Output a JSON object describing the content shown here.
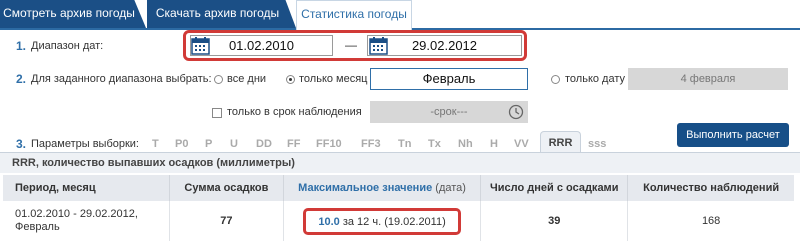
{
  "tabs": [
    {
      "label": "Смотреть архив погоды"
    },
    {
      "label": "Скачать архив погоды"
    },
    {
      "label": "Статистика погоды"
    }
  ],
  "section1": {
    "num": "1.",
    "label": "Диапазон дат:",
    "from": "01.02.2010",
    "sep": "—",
    "to": "29.02.2012"
  },
  "section2": {
    "num": "2.",
    "label": "Для заданного диапазона выбрать:",
    "opt_all": "все дни",
    "opt_month": "только месяц",
    "month_value": "Февраль",
    "opt_date": "только дату",
    "date_value": "4 февраля",
    "obs_label": "только в срок наблюдения",
    "obs_placeholder": "-срок---"
  },
  "section3": {
    "num": "3.",
    "label": "Параметры выборки:",
    "params": [
      "T",
      "P0",
      "P",
      "U",
      "DD",
      "FF",
      "FF10",
      "FF3",
      "Tn",
      "Tx",
      "Nh",
      "H",
      "VV",
      "RRR",
      "sss"
    ],
    "active": "RRR"
  },
  "run_button": "Выполнить расчет",
  "subheader": "RRR, количество выпавших осадков (миллиметры)",
  "table": {
    "headers": {
      "period": "Период, месяц",
      "sum": "Сумма осадков",
      "max_link": "Максимальное значение",
      "max_suffix": "(дата)",
      "days": "Число дней с осадками",
      "count": "Количество наблюдений"
    },
    "row": {
      "period_line1": "01.02.2010 - 29.02.2012,",
      "period_line2": "Февраль",
      "sum": "77",
      "max_value": "10.0",
      "max_detail": "за 12 ч. (19.02.2011)",
      "days": "39",
      "count": "168"
    }
  },
  "colors": {
    "accent": "#2f6fa8",
    "tab_dark": "#1b4f86",
    "button": "#174f88",
    "highlight": "#d13a37"
  },
  "icons": {
    "calendar": "calendar-icon",
    "clock": "clock-icon"
  }
}
